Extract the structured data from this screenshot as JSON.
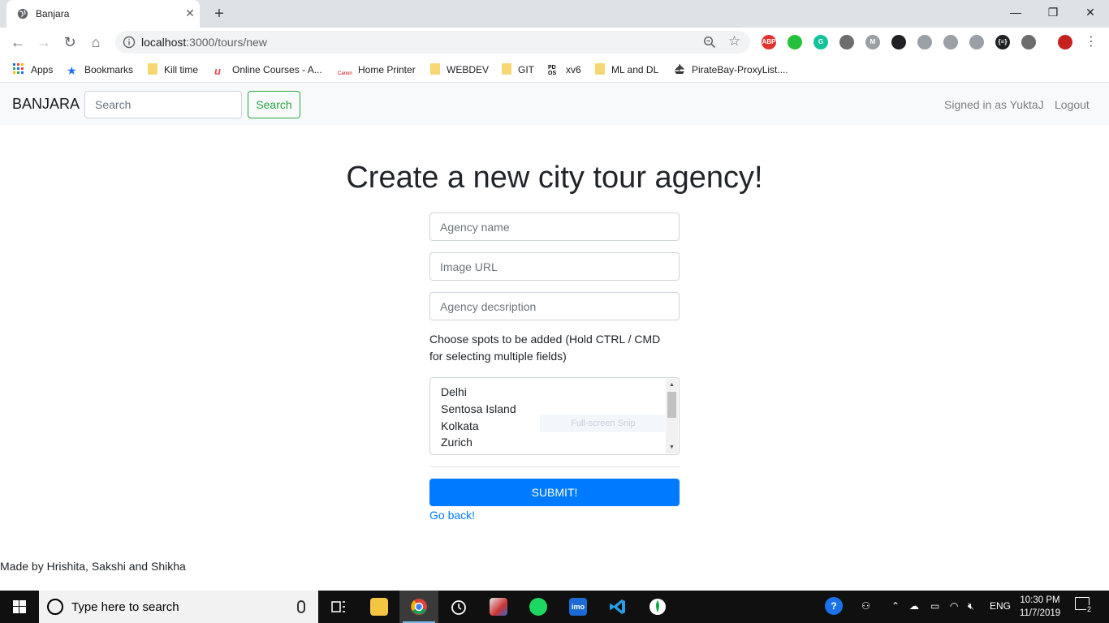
{
  "browser": {
    "tab_title": "Banjara",
    "url_host": "localhost",
    "url_path": ":3000/tours/new",
    "window_controls": {
      "minimize": "—",
      "restore": "❐",
      "close": "✕"
    },
    "extensions": [
      {
        "name": "adblock-icon",
        "text": "ABP",
        "color": "#e4322e"
      },
      {
        "name": "green-ext-icon",
        "text": "",
        "color": "#25c13d"
      },
      {
        "name": "grammarly-icon",
        "text": "G",
        "color": "#15c39a"
      },
      {
        "name": "ext-4-icon",
        "text": "",
        "color": "#6d6d6d"
      },
      {
        "name": "ext-5-icon",
        "text": "M",
        "color": "#9aa0a6"
      },
      {
        "name": "ext-6-icon",
        "text": "",
        "color": "#202124"
      },
      {
        "name": "ext-7-icon",
        "text": "",
        "color": "#9aa0a6"
      },
      {
        "name": "ext-8-icon",
        "text": "",
        "color": "#9aa0a6"
      },
      {
        "name": "ext-9-icon",
        "text": "",
        "color": "#9aa0a6"
      },
      {
        "name": "json-ext-icon",
        "text": "{≡}",
        "color": "#202124"
      },
      {
        "name": "ext-11-icon",
        "text": "",
        "color": "#6d6d6d"
      },
      {
        "name": "profile-avatar",
        "text": "",
        "color": "#c5221f"
      }
    ]
  },
  "bookmarks": [
    {
      "label": "Apps",
      "icon": "apps-grid-icon"
    },
    {
      "label": "Bookmarks",
      "icon": "star-icon"
    },
    {
      "label": "Kill time",
      "icon": "folder-icon"
    },
    {
      "label": "Online Courses - A...",
      "icon": "udemy-icon"
    },
    {
      "label": "Home Printer",
      "icon": "canon-icon"
    },
    {
      "label": "WEBDEV",
      "icon": "folder-icon"
    },
    {
      "label": "GIT",
      "icon": "folder-icon"
    },
    {
      "label": "xv6",
      "icon": "pdos-icon"
    },
    {
      "label": "ML and DL",
      "icon": "folder-icon"
    },
    {
      "label": "PirateBay-ProxyList....",
      "icon": "pirate-ship-icon"
    }
  ],
  "navbar": {
    "brand": "BANJARA",
    "search_placeholder": "Search",
    "search_button": "Search",
    "signed_in": "Signed in as YuktaJ",
    "logout": "Logout"
  },
  "form": {
    "heading": "Create a new city tour agency!",
    "name_placeholder": "Agency name",
    "image_placeholder": "Image URL",
    "description_placeholder": "Agency decsription",
    "spots_label": "Choose spots to be added (Hold CTRL / CMD for selecting multiple fields)",
    "spots": [
      "Delhi",
      "Sentosa Island",
      "Kolkata",
      "Zurich"
    ],
    "overlay_text": "Full-screen Snip",
    "submit": "SUBMIT!",
    "go_back": "Go back!"
  },
  "footer": "Made by Hrishita, Sakshi and Shikha",
  "taskbar": {
    "search_text": "Type here to search",
    "language": "ENG",
    "time": "10:30 PM",
    "date": "11/7/2019",
    "notifications": "2"
  }
}
